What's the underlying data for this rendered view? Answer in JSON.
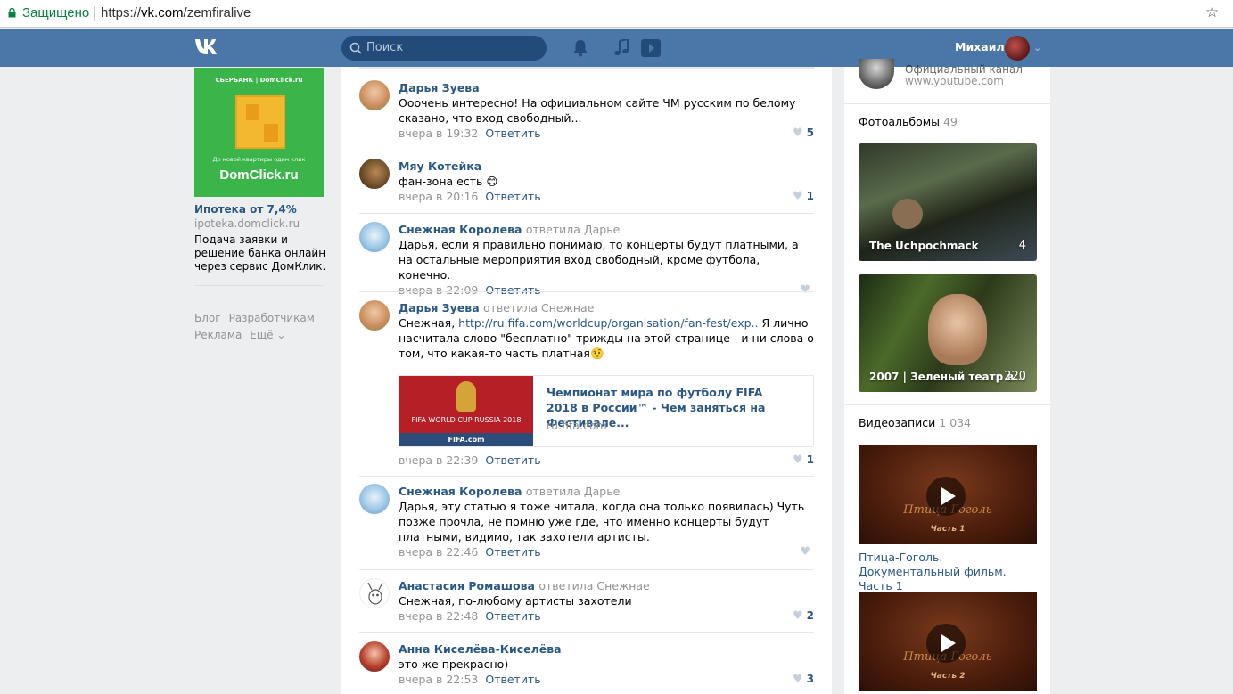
{
  "browser": {
    "secure_label": "Защищено",
    "url_scheme": "https://",
    "url_host": "vk.com",
    "url_path": "/zemfiralive"
  },
  "header": {
    "search_placeholder": "Поиск",
    "user_name": "Михаил"
  },
  "left": {
    "ad": {
      "banner_top": "СБЕРБАНК | DomClick.ru",
      "banner_sub": "До новой квартиры один клик",
      "banner_brand": "DomClick.ru",
      "title": "Ипотека от 7,4%",
      "domain": "ipoteka.domclick.ru",
      "text": "Подача заявки и решение банка онлайн через сервис ДомКлик."
    },
    "footer": [
      "Блог",
      "Разработчикам",
      "Реклама",
      "Ещё ⌄"
    ]
  },
  "comments": [
    {
      "author": "Дарья Зуева",
      "reply_to": "",
      "text": "Ооочень интересно! На официальном сайте ЧМ русским по белому сказано, что вход свободный...",
      "time": "вчера в 19:32",
      "reply": "Ответить",
      "likes": "5"
    },
    {
      "author": "Мяу Котейка",
      "reply_to": "",
      "text": "фан-зона есть 😊",
      "time": "вчера в 20:16",
      "reply": "Ответить",
      "likes": "1"
    },
    {
      "author": "Снежная Королева",
      "reply_to": "ответила Дарье",
      "text": "Дарья, если я правильно понимаю, то концерты будут платными, а на остальные мероприятия вход свободный, кроме футбола, конечно.",
      "time": "вчера в 22:09",
      "reply": "Ответить",
      "likes": ""
    },
    {
      "author": "Дарья Зуева",
      "reply_to": "ответила Снежнае",
      "text_before": "Снежная, ",
      "link": "http://ru.fifa.com/worldcup/organisation/fan-fest/exp..",
      "text_after": " Я лично насчитала слово \"бесплатно\" трижды на этой странице - и ни слова о том, что какая-то часть платная🤨",
      "card": {
        "thumb_text": "FIFA WORLD CUP RUSSIA 2018",
        "thumb_bar": "FIFA.com",
        "title": "Чемпионат мира по футболу FIFA 2018 в России™ - Чем заняться на Фестивале...",
        "domain": "ru.fifa.com"
      },
      "time": "вчера в 22:39",
      "reply": "Ответить",
      "likes": "1"
    },
    {
      "author": "Снежная Королева",
      "reply_to": "ответила Дарье",
      "text": "Дарья, эту статью я тоже читала, когда она только появилась) Чуть позже прочла, не помню уже где, что именно концерты будут платными, видимо, так захотели артисты.",
      "time": "вчера в 22:46",
      "reply": "Ответить",
      "likes": ""
    },
    {
      "author": "Анастасия Ромашова",
      "reply_to": "ответила Снежнае",
      "text": "Снежная, по-любому артисты захотели",
      "time": "вчера в 22:48",
      "reply": "Ответить",
      "likes": "2"
    },
    {
      "author": "Анна Киселёва-Киселёва",
      "reply_to": "",
      "text": "это же прекрасно)",
      "time": "вчера в 22:53",
      "reply": "Ответить",
      "likes": "3"
    }
  ],
  "right": {
    "channel_name": "Официальный канал",
    "channel_url": "www.youtube.com",
    "albums_title": "Фотоальбомы",
    "albums_count": "49",
    "albums": [
      {
        "caption": "The Uchpochmack",
        "count": "4"
      },
      {
        "caption": "2007 | Зеленый театр в...",
        "count": "220"
      }
    ],
    "videos_title": "Видеозаписи",
    "videos_count": "1 034",
    "videos": [
      {
        "overlay_title": "Птица-Гоголь",
        "overlay_part": "Часть 1",
        "caption": "Птица-Гоголь. Документальный фильм. Часть 1"
      },
      {
        "overlay_title": "Птица-Гоголь",
        "overlay_part": "Часть 2",
        "caption": ""
      }
    ]
  },
  "colors": {
    "header_bg": "#4a76a8",
    "link": "#2a5885",
    "page_bg": "#edeef0",
    "muted": "#939393"
  }
}
